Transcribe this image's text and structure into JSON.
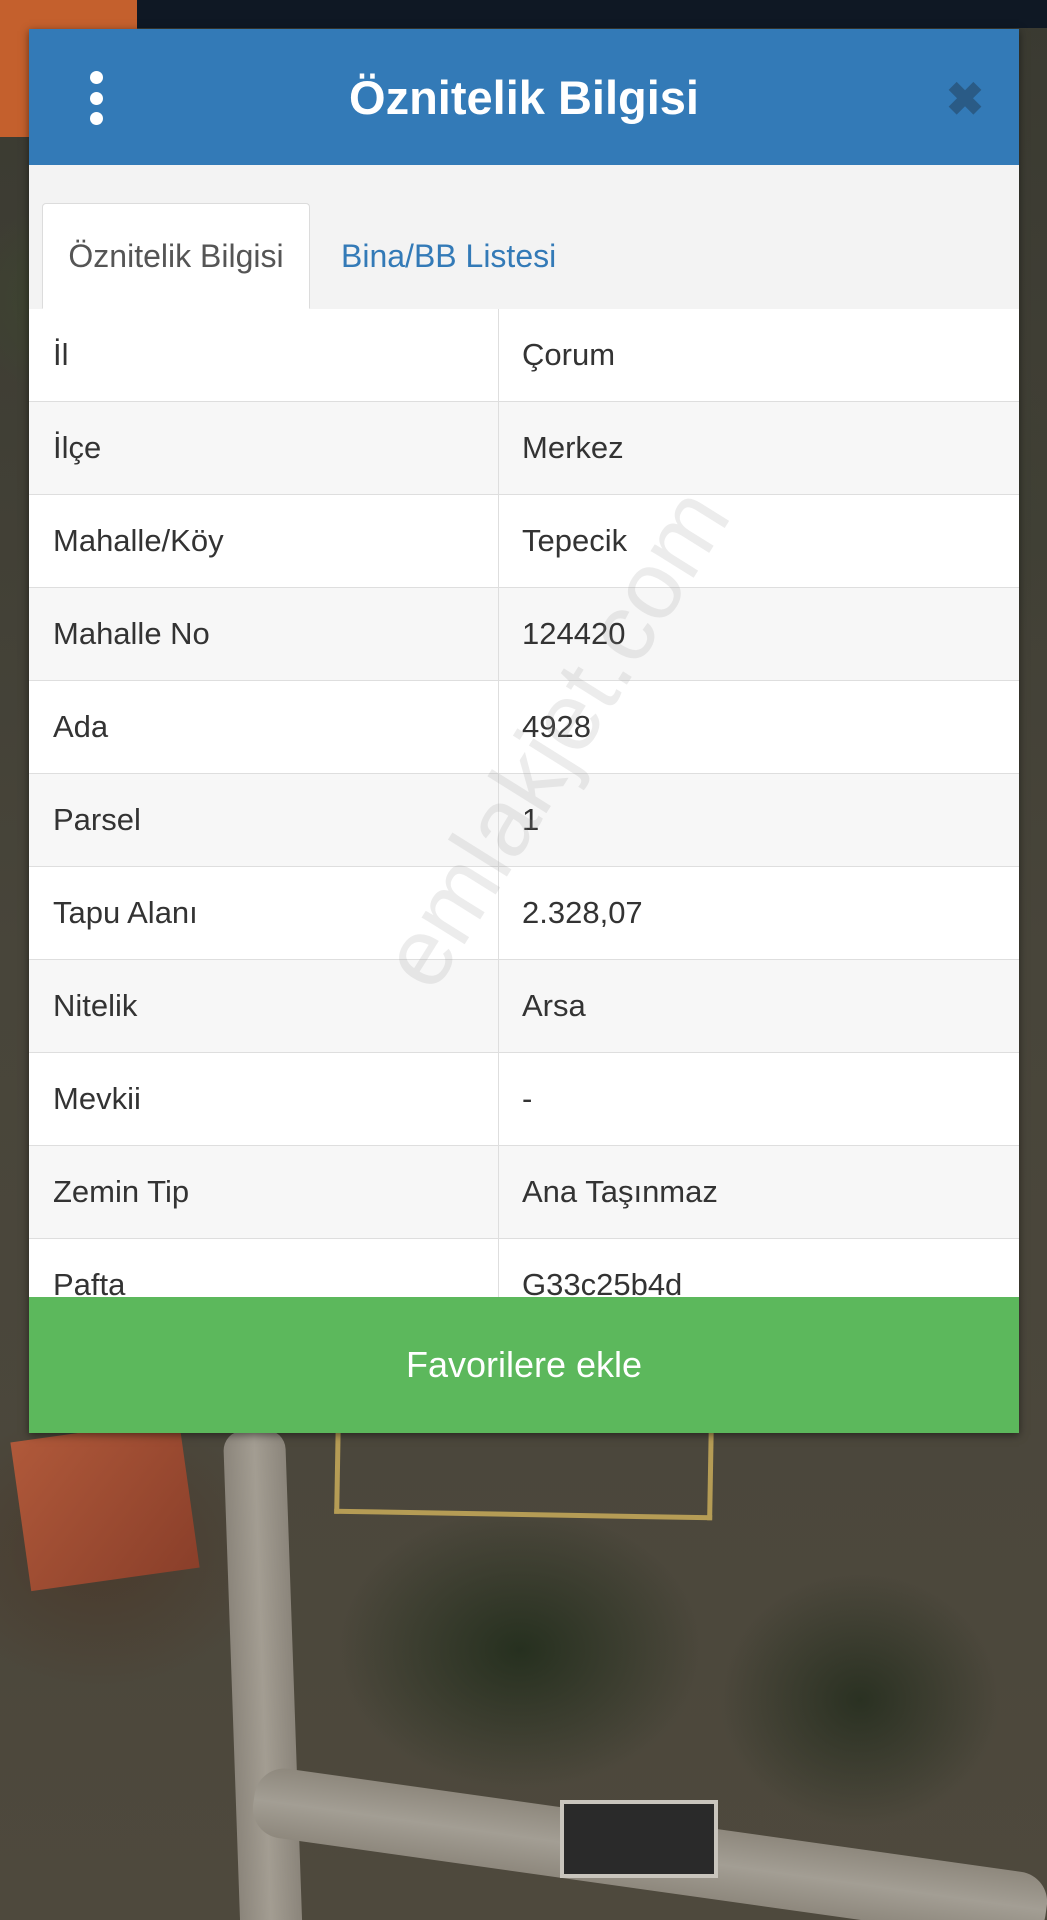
{
  "dialog": {
    "title": "Öznitelik Bilgisi",
    "close_symbol": "✖"
  },
  "tabs": [
    {
      "label": "Öznitelik Bilgisi",
      "active": true
    },
    {
      "label": "Bina/BB Listesi",
      "active": false
    }
  ],
  "attributes": [
    {
      "key": "İl",
      "value": "Çorum"
    },
    {
      "key": "İlçe",
      "value": "Merkez"
    },
    {
      "key": "Mahalle/Köy",
      "value": "Tepecik"
    },
    {
      "key": "Mahalle No",
      "value": "124420"
    },
    {
      "key": "Ada",
      "value": "4928"
    },
    {
      "key": "Parsel",
      "value": "1"
    },
    {
      "key": "Tapu Alanı",
      "value": "2.328,07"
    },
    {
      "key": "Nitelik",
      "value": "Arsa"
    },
    {
      "key": "Mevkii",
      "value": "-"
    },
    {
      "key": "Zemin Tip",
      "value": "Ana Taşınmaz"
    },
    {
      "key": "Pafta",
      "value": "G33c25b4d"
    }
  ],
  "favorite_button": {
    "label": "Favorilere ekle"
  },
  "watermark": "emlakjet.com",
  "colors": {
    "header": "#337ab7",
    "button": "#5cb85c",
    "tab_link": "#337ab7"
  },
  "icons": {
    "menu": "vertical-dots-icon",
    "close": "close-icon"
  }
}
